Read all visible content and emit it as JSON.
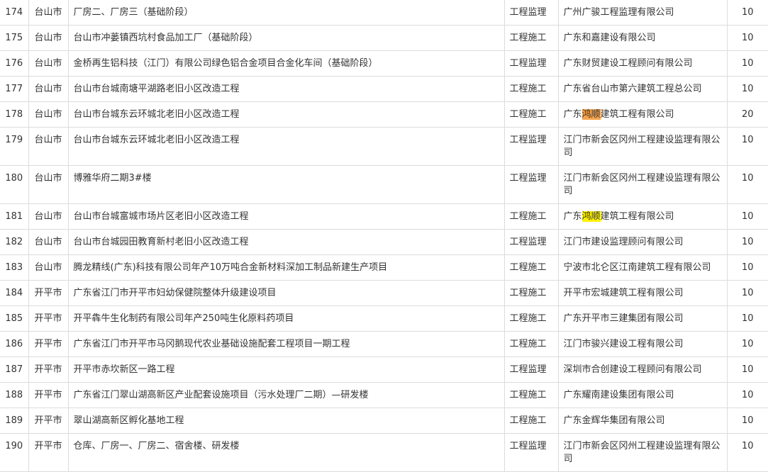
{
  "rows": [
    {
      "no": "174",
      "city": "台山市",
      "project": "厂房二、厂房三（基础阶段）",
      "type": "工程监理",
      "company_pre": "广州广骏工程监理有限公司",
      "company_hl": "",
      "company_post": "",
      "score": "10"
    },
    {
      "no": "175",
      "city": "台山市",
      "project": "台山市冲蒌镇西坑村食品加工厂（基础阶段）",
      "type": "工程施工",
      "company_pre": "广东和嘉建设有限公司",
      "company_hl": "",
      "company_post": "",
      "score": "10"
    },
    {
      "no": "176",
      "city": "台山市",
      "project": "金桥再生铝科技（江门）有限公司绿色铝合金项目合金化车间（基础阶段）",
      "type": "工程监理",
      "company_pre": "广东财贸建设工程顾问有限公司",
      "company_hl": "",
      "company_post": "",
      "score": "10"
    },
    {
      "no": "177",
      "city": "台山市",
      "project": "台山市台城南塘平湖路老旧小区改造工程",
      "type": "工程施工",
      "company_pre": "广东省台山市第六建筑工程总公司",
      "company_hl": "",
      "company_post": "",
      "score": "10"
    },
    {
      "no": "178",
      "city": "台山市",
      "project": "台山市台城东云环城北老旧小区改造工程",
      "type": "工程施工",
      "company_pre": "广东",
      "company_hl": "鸿顺",
      "company_post": "建筑工程有限公司",
      "score": "20"
    },
    {
      "no": "179",
      "city": "台山市",
      "project": "台山市台城东云环城北老旧小区改造工程",
      "type": "工程监理",
      "company_pre": "江门市新会区冈州工程建设监理有限公司",
      "company_hl": "",
      "company_post": "",
      "score": "10"
    },
    {
      "no": "180",
      "city": "台山市",
      "project": "博雅华府二期3#楼",
      "type": "工程监理",
      "company_pre": "江门市新会区冈州工程建设监理有限公司",
      "company_hl": "",
      "company_post": "",
      "score": "10"
    },
    {
      "no": "181",
      "city": "台山市",
      "project": "台山市台城富城市场片区老旧小区改造工程",
      "type": "工程施工",
      "company_pre": "广东",
      "company_hl": "鸿顺",
      "company_post": "建筑工程有限公司",
      "score": "10"
    },
    {
      "no": "182",
      "city": "台山市",
      "project": "台山市台城园田教育新村老旧小区改造工程",
      "type": "工程监理",
      "company_pre": "江门市建设监理顾问有限公司",
      "company_hl": "",
      "company_post": "",
      "score": "10"
    },
    {
      "no": "183",
      "city": "台山市",
      "project": "腾龙精线(广东)科技有限公司年产10万吨合金新材料深加工制品新建生产项目",
      "type": "工程施工",
      "company_pre": "宁波市北仑区江南建筑工程有限公司",
      "company_hl": "",
      "company_post": "",
      "score": "10"
    },
    {
      "no": "184",
      "city": "开平市",
      "project": "广东省江门市开平市妇幼保健院整体升级建设项目",
      "type": "工程施工",
      "company_pre": "开平市宏城建筑工程有限公司",
      "company_hl": "",
      "company_post": "",
      "score": "10"
    },
    {
      "no": "185",
      "city": "开平市",
      "project": "开平犇牛生化制药有限公司年产250吨生化原料药项目",
      "type": "工程施工",
      "company_pre": "广东开平市三建集团有限公司",
      "company_hl": "",
      "company_post": "",
      "score": "10"
    },
    {
      "no": "186",
      "city": "开平市",
      "project": "广东省江门市开平市马冈鹅现代农业基础设施配套工程项目一期工程",
      "type": "工程施工",
      "company_pre": "江门市骏兴建设工程有限公司",
      "company_hl": "",
      "company_post": "",
      "score": "10"
    },
    {
      "no": "187",
      "city": "开平市",
      "project": "开平市赤坎新区一路工程",
      "type": "工程监理",
      "company_pre": "深圳市合创建设工程顾问有限公司",
      "company_hl": "",
      "company_post": "",
      "score": "10"
    },
    {
      "no": "188",
      "city": "开平市",
      "project": "广东省江门翠山湖高新区产业配套设施项目（污水处理厂二期）—研发楼",
      "type": "工程施工",
      "company_pre": "广东耀南建设集团有限公司",
      "company_hl": "",
      "company_post": "",
      "score": "10"
    },
    {
      "no": "189",
      "city": "开平市",
      "project": "翠山湖高新区孵化基地工程",
      "type": "工程施工",
      "company_pre": "广东金辉华集团有限公司",
      "company_hl": "",
      "company_post": "",
      "score": "10"
    },
    {
      "no": "190",
      "city": "开平市",
      "project": "仓库、厂房一、厂房二、宿舍楼、研发楼",
      "type": "工程监理",
      "company_pre": "江门市新会区冈州工程建设监理有限公司",
      "company_hl": "",
      "company_post": "",
      "score": "10"
    }
  ],
  "highlight_colors": [
    "#f7a24a",
    "#fff200"
  ]
}
